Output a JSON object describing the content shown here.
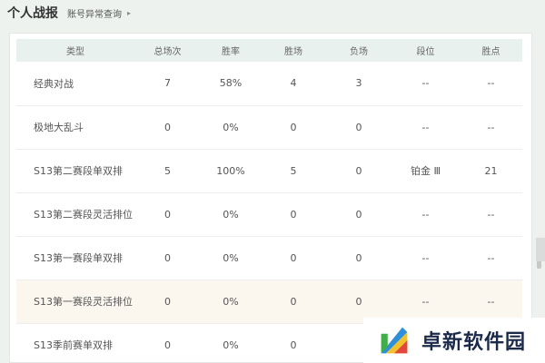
{
  "header": {
    "title": "个人战报",
    "link_label": "账号异常查询",
    "link_arrow": "▸"
  },
  "table": {
    "columns": [
      "类型",
      "总场次",
      "胜率",
      "胜场",
      "负场",
      "段位",
      "胜点"
    ],
    "rows": [
      [
        "经典对战",
        "7",
        "58%",
        "4",
        "3",
        "--",
        "--"
      ],
      [
        "极地大乱斗",
        "0",
        "0%",
        "0",
        "0",
        "--",
        "--"
      ],
      [
        "S13第二赛段单双排",
        "5",
        "100%",
        "5",
        "0",
        "铂金 Ⅲ",
        "21"
      ],
      [
        "S13第二赛段灵活排位",
        "0",
        "0%",
        "0",
        "0",
        "--",
        "--"
      ],
      [
        "S13第一赛段单双排",
        "0",
        "0%",
        "0",
        "0",
        "--",
        "--"
      ],
      [
        "S13第一赛段灵活排位",
        "0",
        "0%",
        "0",
        "0",
        "--",
        "--"
      ],
      [
        "S13季前赛单双排",
        "0",
        "0%",
        "0",
        "",
        "",
        ""
      ]
    ]
  },
  "watermark": {
    "text": "卓新软件园",
    "logo_icon": "zhuoxin-logo-icon",
    "colors": [
      "#2f8fd8",
      "#f2c12e",
      "#e3463b",
      "#3fae49",
      "#1c2a4a"
    ]
  }
}
